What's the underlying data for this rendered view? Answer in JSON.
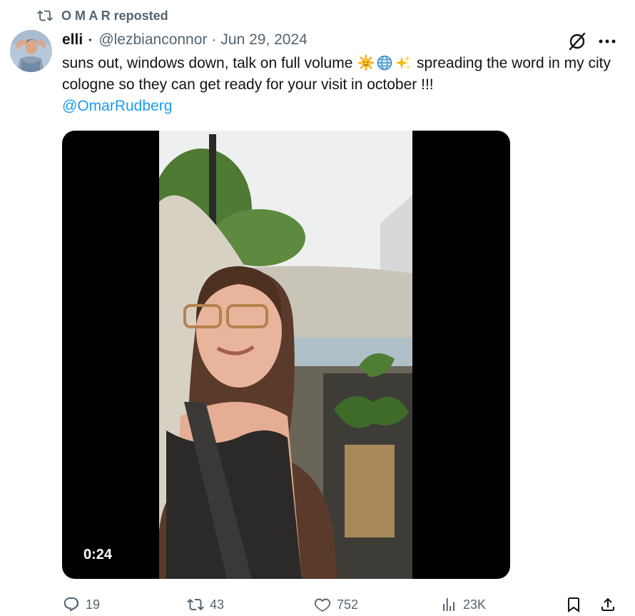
{
  "repost": {
    "text": "O M A R reposted",
    "icon": "repost-icon"
  },
  "author": {
    "display_name": "elli",
    "badge": "⋆",
    "handle": "@lezbianconnor",
    "separator": "·",
    "date": "Jun 29, 2024"
  },
  "tweet": {
    "text_part1": "suns out, windows down, talk on full volume ",
    "emojis": [
      "sun-with-face",
      "globe-with-meridians",
      "sparkles"
    ],
    "text_part2": " spreading the word in my city cologne so they can get ready for your visit in october !!!",
    "mention": "@OmarRudberg"
  },
  "media": {
    "duration": "0:24"
  },
  "metrics": {
    "replies": "19",
    "reposts": "43",
    "likes": "752",
    "views": "23K"
  },
  "colors": {
    "accent": "#1d9bf0",
    "secondary_text": "#536471",
    "primary_text": "#0f1419"
  }
}
